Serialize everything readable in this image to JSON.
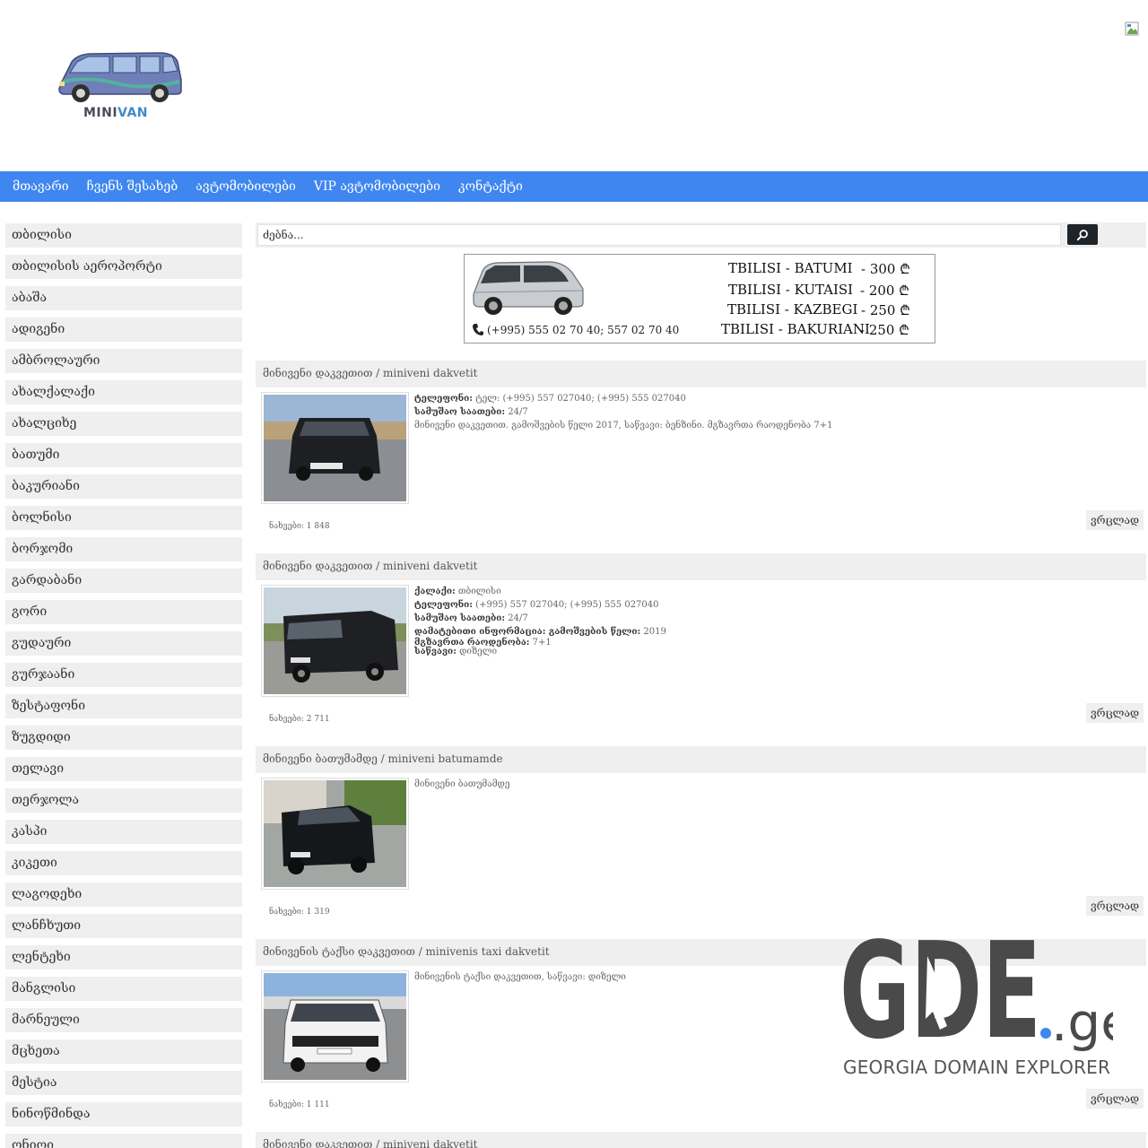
{
  "header": {
    "logo_text_1": "MINI",
    "logo_text_2": "VAN"
  },
  "nav": {
    "items": [
      "მთავარი",
      "ჩვენს შესახებ",
      "ავტომობილები",
      "VIP ავტომობილები",
      "კონტაქტი"
    ]
  },
  "sidebar": {
    "items": [
      "თბილისი",
      "თბილისის აეროპორტი",
      "აბაშა",
      "ადიგენი",
      "ამბროლაური",
      "ახალქალაქი",
      "ახალციხე",
      "ბათუმი",
      "ბაკურიანი",
      "ბოლნისი",
      "ბორჯომი",
      "გარდაბანი",
      "გორი",
      "გუდაური",
      "გურჯაანი",
      "ზესტაფონი",
      "ზუგდიდი",
      "თელავი",
      "თერჯოლა",
      "კასპი",
      "კიკეთი",
      "ლაგოდეხი",
      "ლანჩხუთი",
      "ლენტეხი",
      "მანგლისი",
      "მარნეული",
      "მცხეთა",
      "მესტია",
      "ნინოწმინდა",
      "ონიოი"
    ]
  },
  "search": {
    "placeholder": "ძებნა..."
  },
  "banner": {
    "phone": "(+995) 555 02 70 40; 557 02 70 40",
    "routes": [
      {
        "name": "TBILISI - BATUMI",
        "price": "- 300 ₾"
      },
      {
        "name": "TBILISI - KUTAISI",
        "price": "- 200 ₾"
      },
      {
        "name": "TBILISI - KAZBEGI",
        "price": "- 250 ₾"
      },
      {
        "name": "TBILISI - BAKURIANI",
        "price": "- 250 ₾"
      }
    ]
  },
  "listings": [
    {
      "title": "მინივენი დაკვეთით / miniveni dakvetit",
      "lines": [
        {
          "label": "ტელეფონი:",
          "value": " ტელ: (+995) 557 027040; (+995) 555 027040"
        },
        {
          "label": "სამუშაო საათები:",
          "value": " 24/7"
        },
        {
          "label": "",
          "value": "მინივენი დაკვეთით. გამოშვების წელი 2017, საწვავი: ბენზინი. მგზავრთა რაოდენობა 7+1"
        }
      ],
      "views": "ნახვები: 1 848",
      "detail_label": "ვრცლად"
    },
    {
      "title": "მინივენი დაკვეთით / miniveni dakvetit",
      "lines": [
        {
          "label": "ქალაქი:",
          "value": " თბილისი"
        },
        {
          "label": "ტელეფონი:",
          "value": " (+995) 557 027040; (+995) 555 027040"
        },
        {
          "label": "სამუშაო საათები:",
          "value": " 24/7"
        },
        {
          "label": "დამატებითი ინფორმაცია: გამოშვების წელი:",
          "value": " 2019"
        },
        {
          "label": "მგზავრთა რაოდენობა:",
          "value": " 7+1"
        },
        {
          "label": "საწვავი:",
          "value": " დიზელი"
        }
      ],
      "views": "ნახვები: 2 711",
      "detail_label": "ვრცლად"
    },
    {
      "title": "მინივენი ბათუმამდე / miniveni batumamde",
      "lines": [
        {
          "label": "",
          "value": "მინივენი ბათუმამდე"
        }
      ],
      "views": "ნახვები: 1 319",
      "detail_label": "ვრცლად"
    },
    {
      "title": "მინივენის ტაქსი დაკვეთით / minivenis taxi dakvetit",
      "lines": [
        {
          "label": "",
          "value": "მინივენის ტაქსი დაკვეთით, საწვავი: დიზელი"
        }
      ],
      "views": "ნახვები: 1 111",
      "detail_label": "ვრცლად"
    },
    {
      "title": "მინივენი დაკვეთით / miniveni dakvetit",
      "lines": [],
      "views": "",
      "detail_label": ""
    }
  ],
  "watermark": {
    "brand_main": "GDE",
    "brand_tld": ".ge",
    "tagline": "GEORGIA DOMAIN EXPLORER"
  },
  "colors": {
    "nav_bg": "#3f86f0",
    "panel_bg": "#efefef",
    "search_btn": "#1f2428"
  }
}
